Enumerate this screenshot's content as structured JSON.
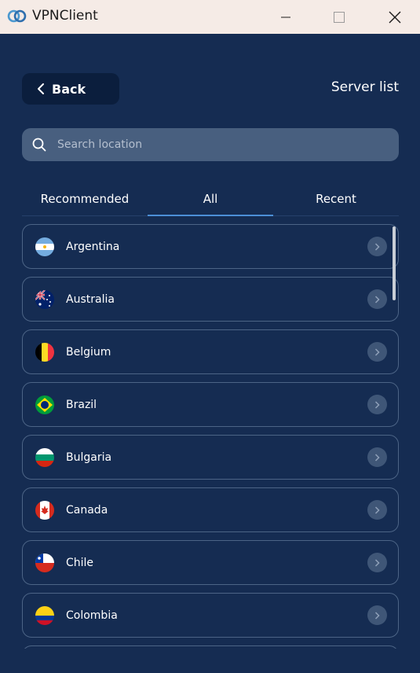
{
  "window": {
    "title": "VPNClient"
  },
  "header": {
    "back_label": "Back",
    "page_title": "Server list"
  },
  "search": {
    "placeholder": "Search location"
  },
  "tabs": [
    {
      "label": "Recommended",
      "active": false
    },
    {
      "label": "All",
      "active": true
    },
    {
      "label": "Recent",
      "active": false
    }
  ],
  "servers": [
    {
      "name": "Argentina",
      "flag": "argentina-flag-icon"
    },
    {
      "name": "Australia",
      "flag": "australia-flag-icon"
    },
    {
      "name": "Belgium",
      "flag": "belgium-flag-icon"
    },
    {
      "name": "Brazil",
      "flag": "brazil-flag-icon"
    },
    {
      "name": "Bulgaria",
      "flag": "bulgaria-flag-icon"
    },
    {
      "name": "Canada",
      "flag": "canada-flag-icon"
    },
    {
      "name": "Chile",
      "flag": "chile-flag-icon"
    },
    {
      "name": "Colombia",
      "flag": "colombia-flag-icon"
    }
  ],
  "colors": {
    "background": "#152c52",
    "accent": "#4c8fd6",
    "titlebar": "#f5ebe6"
  }
}
